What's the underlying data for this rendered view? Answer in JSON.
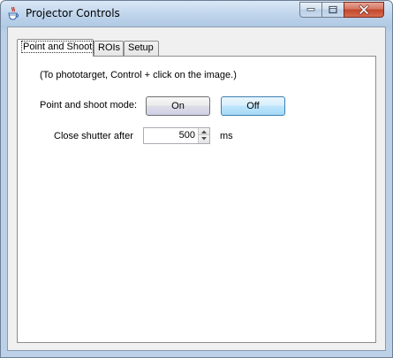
{
  "window": {
    "title": "Projector Controls",
    "icons": {
      "app": "java-coffee-cup-icon",
      "minimize": "minimize-icon",
      "maximize": "maximize-icon",
      "close": "close-icon"
    }
  },
  "tabs": [
    {
      "label": "Point and Shoot",
      "active": true
    },
    {
      "label": "ROIs",
      "active": false
    },
    {
      "label": "Setup",
      "active": false
    }
  ],
  "point_and_shoot": {
    "hint": "(To phototarget, Control + click on the image.)",
    "mode_label": "Point and shoot mode:",
    "on_label": "On",
    "off_label": "Off",
    "shutter_label": "Close shutter after",
    "shutter_value": "500",
    "shutter_unit": "ms"
  },
  "colors": {
    "close_button": "#c2462c",
    "off_button": "#bee6fd",
    "panel_background": "#ffffff"
  }
}
